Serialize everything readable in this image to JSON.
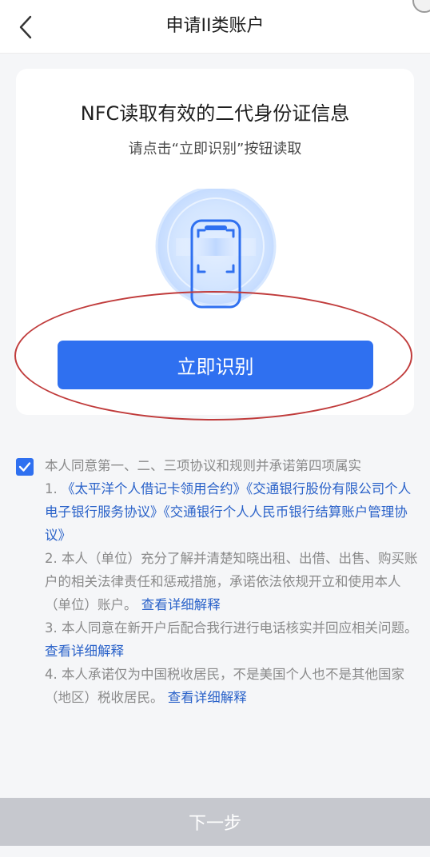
{
  "header": {
    "title": "申请II类账户"
  },
  "card": {
    "title": "NFC读取有效的二代身份证信息",
    "subtitle": "请点击“立即识别”按钮读取",
    "button_label": "立即识别"
  },
  "agreement": {
    "intro": "本人同意第一、二、三项协议和规则并承诺第四项属实",
    "item1_prefix": "1. ",
    "item1_link1": "《太平洋个人借记卡领用合约》",
    "item1_link2": "《交通银行股份有限公司个人电子银行服务协议》",
    "item1_link3": "《交通银行个人人民币银行结算账户管理协议》",
    "item2_text": "2. 本人（单位）充分了解并清楚知晓出租、出借、出售、购买账户的相关法律责任和惩戒措施，承诺依法依规开立和使用本人（单位）账户。",
    "item2_link": "查看详细解释",
    "item3_text": "3. 本人同意在新开户后配合我行进行电话核实并回应相关问题。",
    "item3_link": "查看详细解释",
    "item4_text": "4. 本人承诺仅为中国税收居民，不是美国个人也不是其他国家（地区）税收居民。",
    "item4_link": "查看详细解释"
  },
  "footer": {
    "next_label": "下一步"
  },
  "colors": {
    "accent": "#2f70f0",
    "link": "#2a62c9",
    "disabled": "#c6c8ce",
    "annotation": "#c03b3b"
  },
  "icons": {
    "back": "chevron-left-icon",
    "checkbox": "checkmark-icon",
    "illustration": "nfc-phone-icon"
  }
}
